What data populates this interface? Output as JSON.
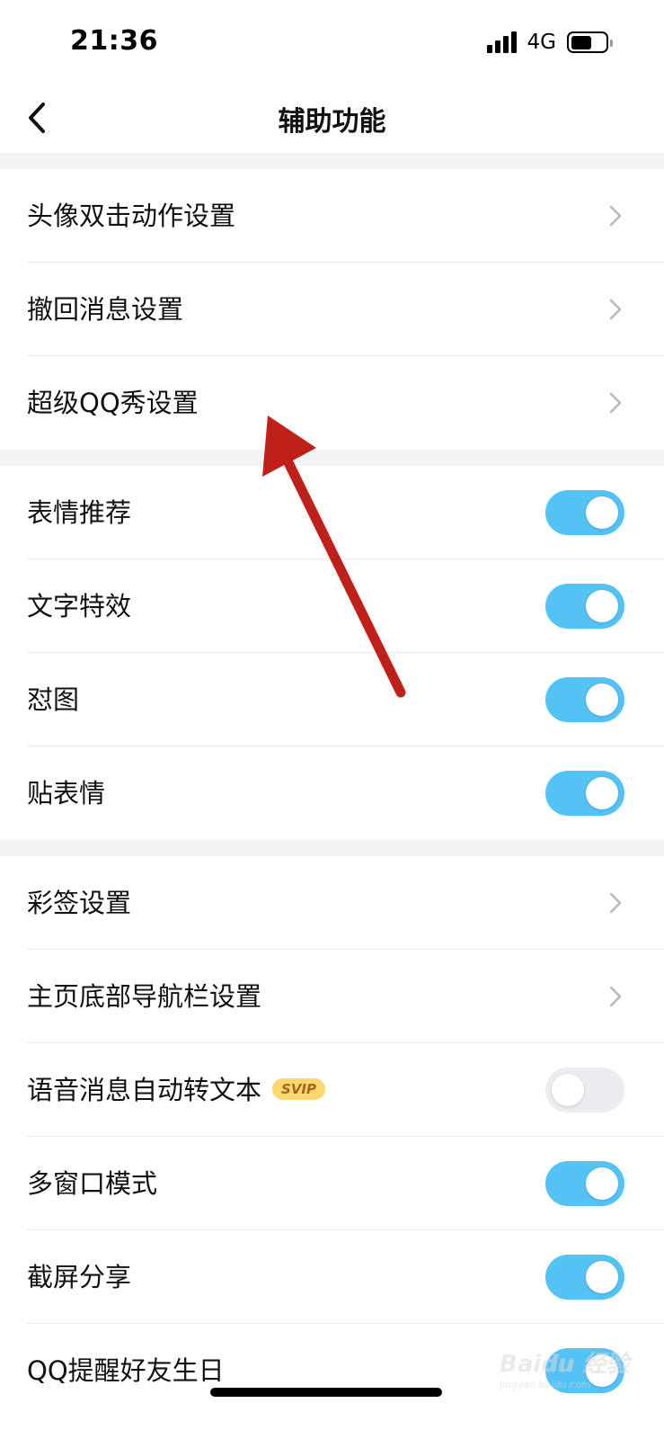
{
  "status_bar": {
    "time": "21:36",
    "network": "4G"
  },
  "nav": {
    "title": "辅助功能"
  },
  "rows": [
    {
      "id": "avatar-double-tap",
      "label": "头像双击动作设置",
      "control": "chevron"
    },
    {
      "id": "recall-message",
      "label": "撤回消息设置",
      "control": "chevron"
    },
    {
      "id": "super-qq-show",
      "label": "超级QQ秀设置",
      "control": "chevron"
    },
    {
      "id": "emoji-recommend",
      "label": "表情推荐",
      "control": "toggle",
      "on": true
    },
    {
      "id": "text-effects",
      "label": "文字特效",
      "control": "toggle",
      "on": true
    },
    {
      "id": "meme-reply",
      "label": "怼图",
      "control": "toggle",
      "on": true
    },
    {
      "id": "sticker",
      "label": "贴表情",
      "control": "toggle",
      "on": true
    },
    {
      "id": "color-tag",
      "label": "彩签设置",
      "control": "chevron"
    },
    {
      "id": "bottom-nav",
      "label": "主页底部导航栏设置",
      "control": "chevron"
    },
    {
      "id": "voice-to-text",
      "label": "语音消息自动转文本",
      "badge": "SVIP",
      "control": "toggle",
      "on": false
    },
    {
      "id": "multi-window",
      "label": "多窗口模式",
      "control": "toggle",
      "on": true
    },
    {
      "id": "screenshot-share",
      "label": "截屏分享",
      "control": "toggle",
      "on": true
    },
    {
      "id": "birthday-reminder",
      "label": "QQ提醒好友生日",
      "control": "toggle",
      "on": true
    }
  ],
  "watermark": {
    "text": "Baidu 经验",
    "subtext": "jingyan.baidu.com"
  },
  "colors": {
    "toggle_on": "#55c2f5",
    "toggle_off": "#ebebf0",
    "group_gap": "#f2f3f5",
    "arrow": "#c0201a",
    "badge_bg": "#ffd76e"
  },
  "icons": {
    "back": "chevron-left-icon",
    "row_arrow": "chevron-right-icon"
  }
}
